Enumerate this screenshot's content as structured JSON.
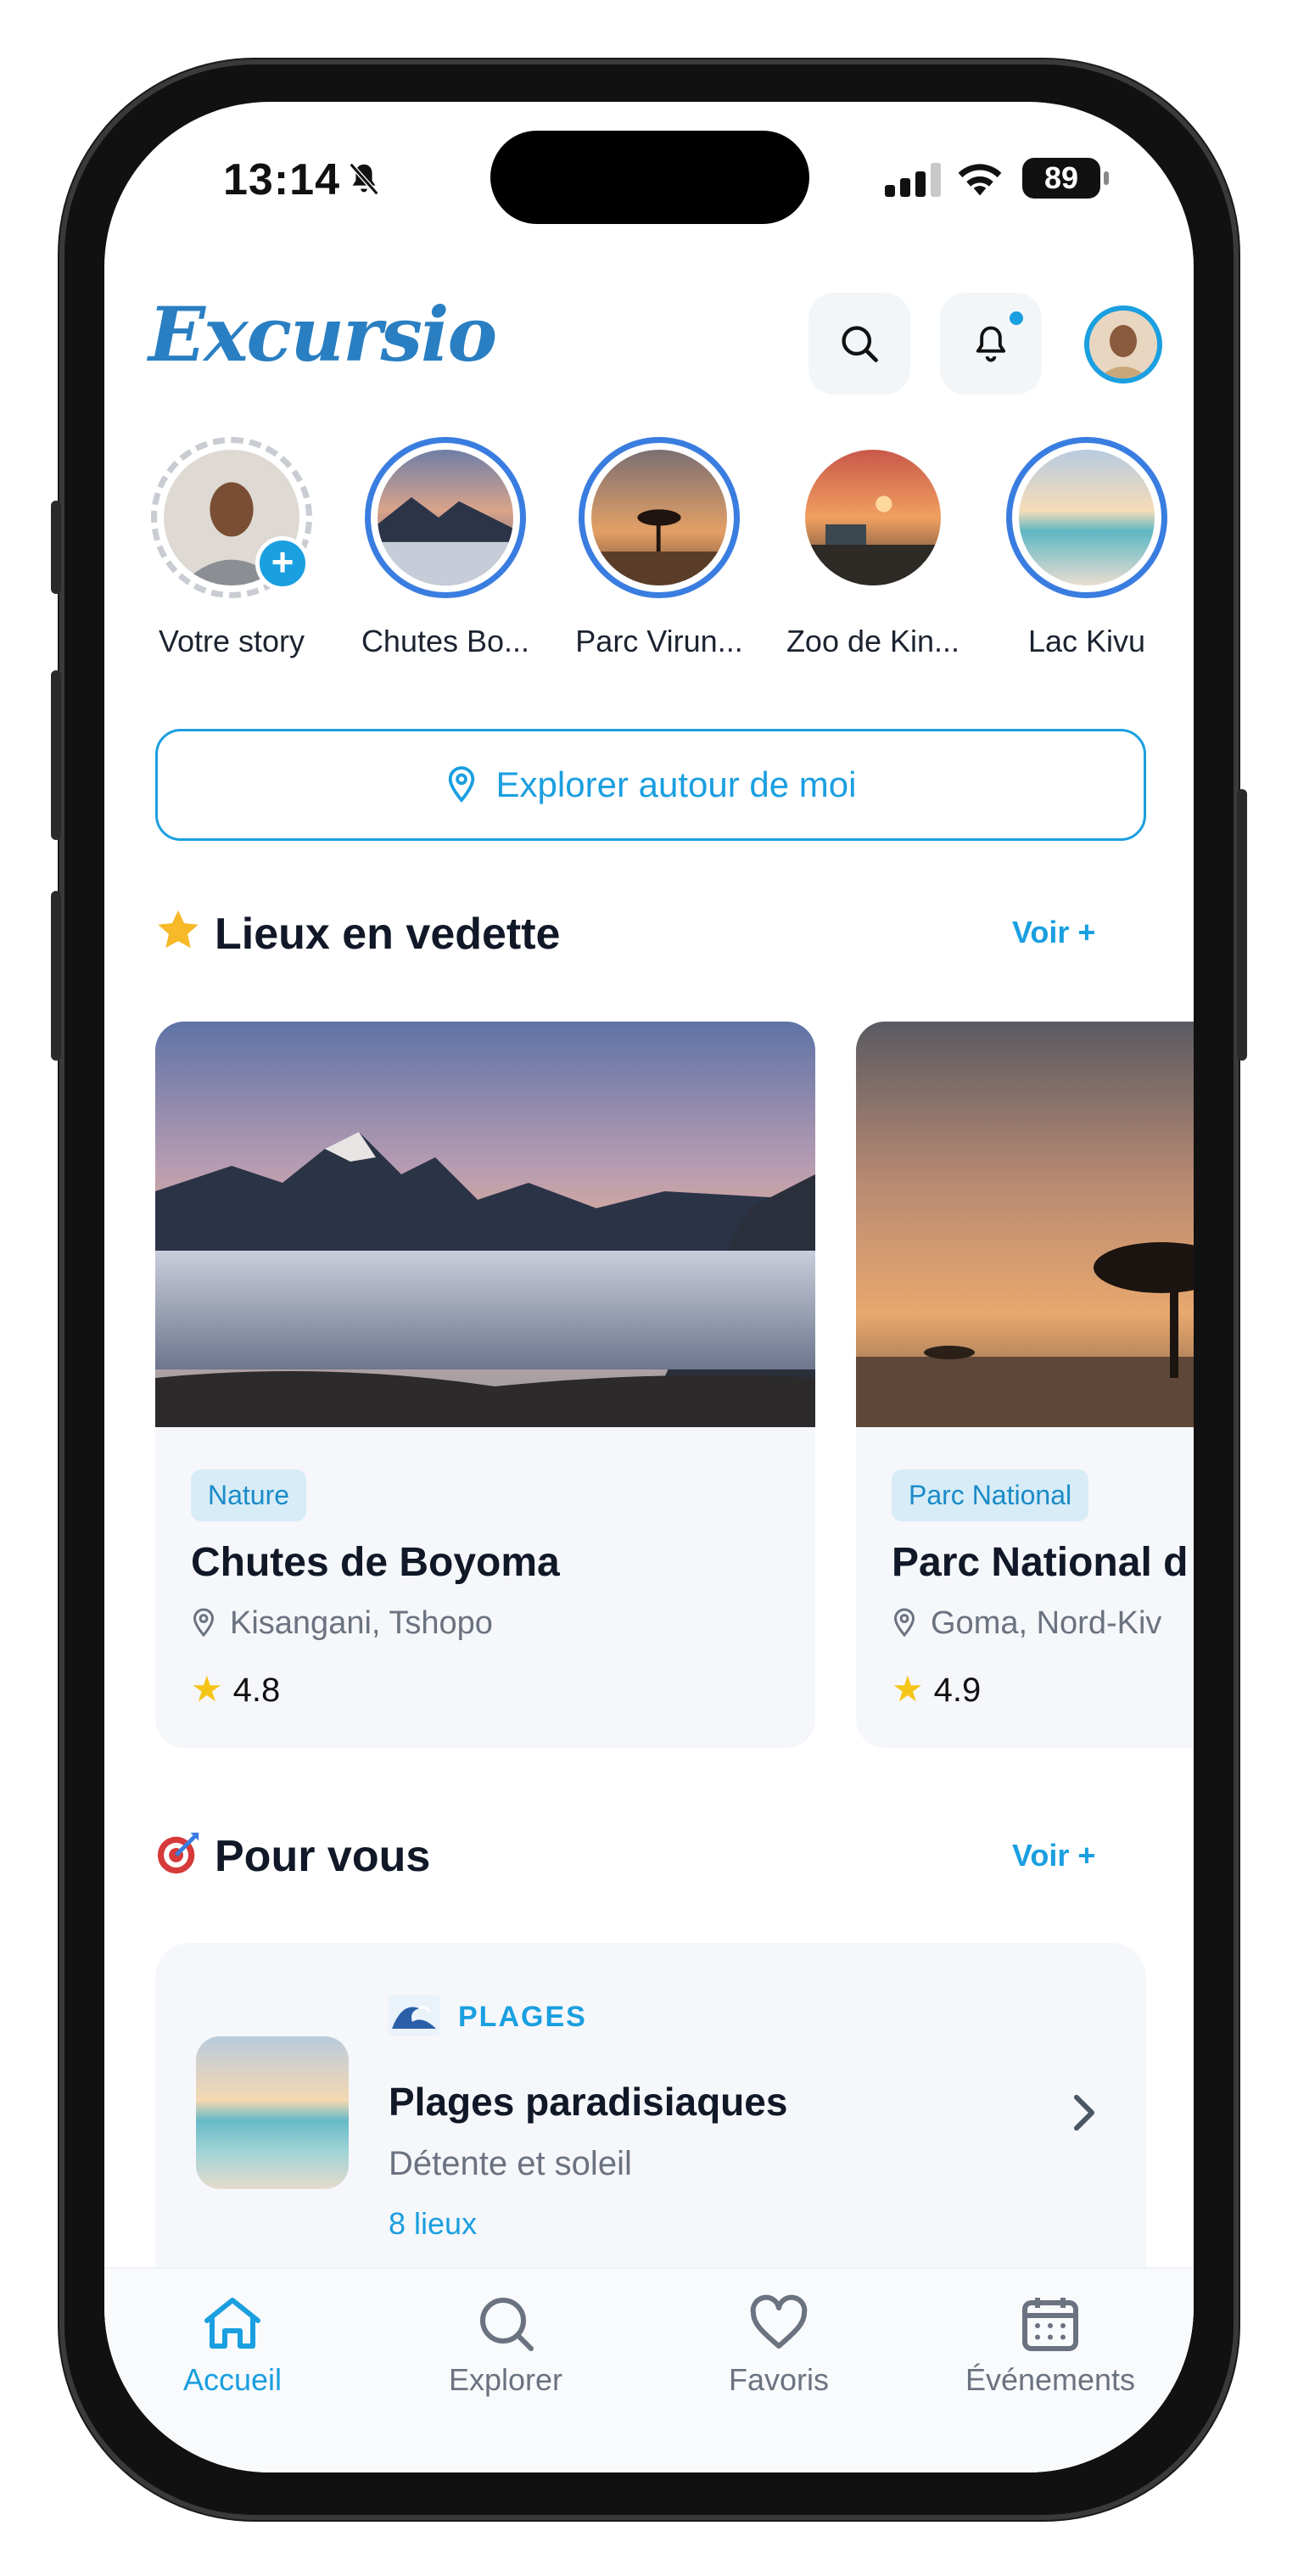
{
  "status_bar": {
    "time": "13:14",
    "battery": "89"
  },
  "header": {
    "logo": "Excursio",
    "icons": [
      "search-icon",
      "bell-icon",
      "avatar"
    ]
  },
  "stories": [
    {
      "label": "Votre story",
      "own": true
    },
    {
      "label": "Chutes Bo..."
    },
    {
      "label": "Parc Virun..."
    },
    {
      "label": "Zoo de Kin..."
    },
    {
      "label": "Lac Kivu"
    }
  ],
  "explore_button": {
    "label": "Explorer autour de moi",
    "icon": "location-pin-icon"
  },
  "featured": {
    "title": "Lieux en vedette",
    "emoji": "star",
    "see_more": "Voir +",
    "cards": [
      {
        "tag": "Nature",
        "title": "Chutes de Boyoma",
        "location": "Kisangani, Tshopo",
        "rating": "4.8"
      },
      {
        "tag": "Parc National",
        "title": "Parc National d",
        "location": "Goma, Nord-Kiv",
        "rating": "4.9"
      }
    ]
  },
  "for_you": {
    "title": "Pour vous",
    "emoji": "target",
    "see_more": "Voir +",
    "item": {
      "category": "PLAGES",
      "title": "Plages paradisiaques",
      "subtitle": "Détente et soleil",
      "count": "8 lieux"
    }
  },
  "bottom_nav": [
    {
      "label": "Accueil",
      "icon": "home-icon",
      "active": true
    },
    {
      "label": "Explorer",
      "icon": "search-icon"
    },
    {
      "label": "Favoris",
      "icon": "heart-icon"
    },
    {
      "label": "Événements",
      "icon": "calendar-icon"
    }
  ],
  "colors": {
    "accent": "#1a9fe0",
    "story_ring": "#3a7de0",
    "star": "#f5c518",
    "text_primary": "#111827",
    "text_muted": "#6b7280"
  }
}
